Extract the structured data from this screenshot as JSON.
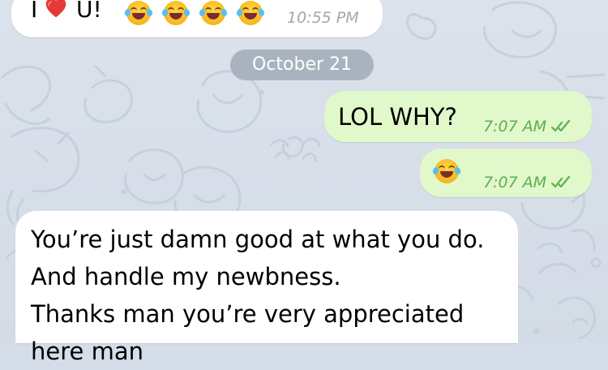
{
  "conversation": {
    "messages": [
      {
        "kind": "incoming",
        "text_prefix": "I",
        "heart_icon": "red-heart-icon",
        "text_suffix": "U!",
        "emoji_icon": "face-with-tears-of-joy-icon",
        "time": "10:55 PM"
      },
      {
        "kind": "date",
        "text": "October 21"
      },
      {
        "kind": "outgoing",
        "text": "LOL WHY?",
        "time": "7:07 AM",
        "status_icon": "double-check-icon"
      },
      {
        "kind": "outgoing",
        "emoji_icon": "face-with-tears-of-joy-icon",
        "time": "7:07 AM",
        "status_icon": "double-check-icon"
      },
      {
        "kind": "incoming",
        "lines": [
          "You’re just damn good at what you do.",
          "And handle my newbness.",
          "Thanks man you’re very appreciated",
          "here man"
        ]
      }
    ]
  },
  "colors": {
    "background": "#d5dde8",
    "incoming_bubble": "#ffffff",
    "outgoing_bubble": "#e1f8cb",
    "date_pill": "#a9b3bf",
    "incoming_time": "#a3a8ae",
    "outgoing_time": "#5dae4f",
    "heart": "#e53935"
  }
}
